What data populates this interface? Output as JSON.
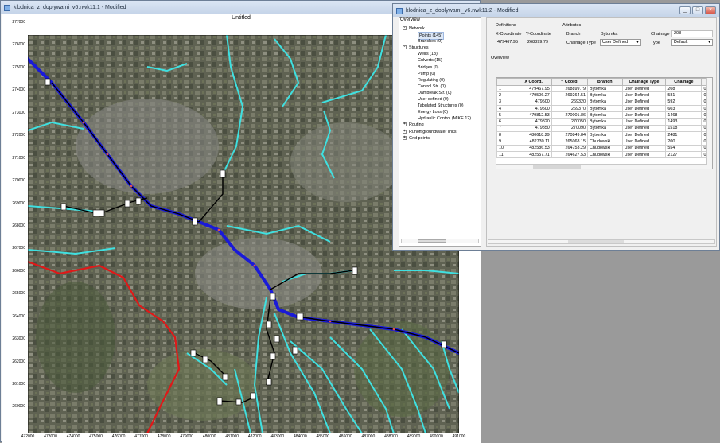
{
  "map_window": {
    "title": "klodnica_z_doplywami_v6.nwk11:1 - Modified",
    "canvas_title": "Untitled",
    "y_ticks": [
      "277000",
      "276000",
      "275000",
      "274000",
      "273000",
      "272000",
      "271000",
      "270000",
      "269000",
      "268000",
      "267000",
      "266000",
      "265000",
      "264000",
      "263000",
      "262000",
      "261000",
      "260000"
    ],
    "x_ticks": [
      "472000",
      "473000",
      "474000",
      "475000",
      "476000",
      "477000",
      "478000",
      "479000",
      "480000",
      "481000",
      "482000",
      "483000",
      "484000",
      "485000",
      "486000",
      "487000",
      "488000",
      "489000",
      "490000",
      "491000"
    ]
  },
  "overview_window": {
    "title": "klodnica_z_doplywami_v6.nwk11:2 - Modified",
    "window_buttons": [
      "_",
      "□",
      "×"
    ],
    "overview_label": "Overview",
    "tree": [
      {
        "label": "Network",
        "level": 0,
        "expander": "-"
      },
      {
        "label": "Points (145)",
        "level": 1,
        "selected": true
      },
      {
        "label": "Branches (9)",
        "level": 1
      },
      {
        "label": "Structures",
        "level": 0,
        "expander": "-"
      },
      {
        "label": "Weirs (13)",
        "level": 1
      },
      {
        "label": "Culverts (15)",
        "level": 1
      },
      {
        "label": "Bridges (0)",
        "level": 1
      },
      {
        "label": "Pump (0)",
        "level": 1
      },
      {
        "label": "Regulating (0)",
        "level": 1
      },
      {
        "label": "Control Str. (0)",
        "level": 1
      },
      {
        "label": "Dambreak Str. (0)",
        "level": 1
      },
      {
        "label": "User defined (0)",
        "level": 1
      },
      {
        "label": "Tabulated Structures (0)",
        "level": 1
      },
      {
        "label": "Energy Loss (0)",
        "level": 1
      },
      {
        "label": "Hydraulic Control (MIKE 12)...",
        "level": 1
      },
      {
        "label": "Routing",
        "level": 0,
        "expander": "+"
      },
      {
        "label": "Runoff/groundwater links",
        "level": 0,
        "expander": "+"
      },
      {
        "label": "Grid points",
        "level": 0,
        "expander": "+"
      }
    ],
    "definitions": {
      "heading": "Definitions",
      "x_label": "X-Coordinate",
      "y_label": "Y-Coordinate",
      "x_value": "479467.95",
      "y_value": "268899.79"
    },
    "attributes": {
      "heading": "Attributes",
      "branch_label": "Branch",
      "branch_value": "Bytomka",
      "chainage_type_label": "Chainage Type",
      "chainage_type_value": "User Defined",
      "chainage_label": "Chainage",
      "chainage_value": "208",
      "type_label": "Type",
      "type_value": "Default"
    },
    "table_heading": "Overview",
    "columns": [
      "",
      "X Coord.",
      "Y Coord.",
      "Branch",
      "Chainage Type",
      "Chainage",
      ""
    ],
    "rows": [
      [
        "1",
        "479467.95",
        "268899.79",
        "Bytomka",
        "User Defined",
        "208",
        "0"
      ],
      [
        "2",
        "479506.27",
        "269264.51",
        "Bytomka",
        "User Defined",
        "581",
        "0"
      ],
      [
        "3",
        "479500",
        "269320",
        "Bytomka",
        "User Defined",
        "592",
        "0"
      ],
      [
        "4",
        "479500",
        "269370",
        "Bytomka",
        "User Defined",
        "603",
        "0"
      ],
      [
        "5",
        "479812.53",
        "270001.86",
        "Bytomka",
        "User Defined",
        "1468",
        "0"
      ],
      [
        "6",
        "479820",
        "270050",
        "Bytomka",
        "User Defined",
        "1493",
        "0"
      ],
      [
        "7",
        "479850",
        "270090",
        "Bytomka",
        "User Defined",
        "1518",
        "0"
      ],
      [
        "8",
        "480618.29",
        "270849.84",
        "Bytomka",
        "User Defined",
        "2481",
        "0"
      ],
      [
        "9",
        "482730.11",
        "265068.15",
        "Chudowski",
        "User Defined",
        "200",
        "0"
      ],
      [
        "10",
        "482586.53",
        "264753.29",
        "Chudowski",
        "User Defined",
        "554",
        "0"
      ],
      [
        "11",
        "482557.71",
        "264627.53",
        "Chudowski",
        "User Defined",
        "2127",
        "0"
      ]
    ]
  },
  "colors": {
    "river_blue": "#1a1ad8",
    "tributary_cyan": "#3fe0e0",
    "catchment_red": "#e01818",
    "title_gradient": "#c4d3e8"
  }
}
